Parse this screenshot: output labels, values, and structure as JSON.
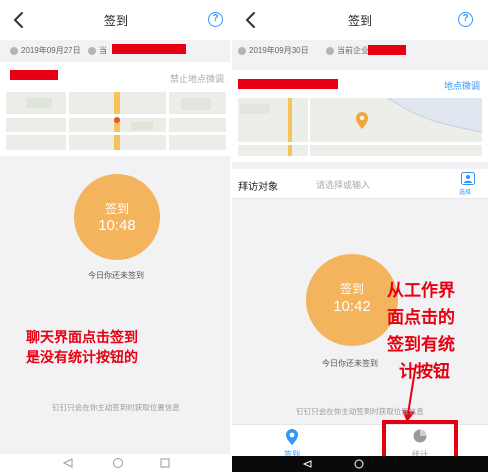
{
  "left": {
    "header": {
      "title": "签到"
    },
    "info": {
      "date": "2019年09月27日",
      "company_prefix": "当"
    },
    "location": {
      "action": "禁止地点微调"
    },
    "sign": {
      "label": "签到",
      "time": "10:48"
    },
    "status": "今日你还未签到",
    "privacy": "钉钉只会在你主动签到时获取位置信息",
    "annotation": [
      "聊天界面点击签到",
      "是没有统计按钮的"
    ]
  },
  "right": {
    "header": {
      "title": "签到"
    },
    "info": {
      "date": "2019年09月30日",
      "company_prefix": "当前企业"
    },
    "location": {
      "action": "地点微调"
    },
    "visit": {
      "label": "拜访对象",
      "placeholder": "请选择或输入",
      "select_label": "选择"
    },
    "sign": {
      "label": "签到",
      "time": "10:42"
    },
    "status": "今日你还未签到",
    "privacy": "钉钉只会在你主动签到时获取位置信息",
    "annotation": [
      "从工作界",
      "面点击的",
      "签到有统",
      "计按钮"
    ],
    "tabs": [
      {
        "label": "签到",
        "icon": "location-person-icon",
        "active": true
      },
      {
        "label": "统计",
        "icon": "pie-chart-icon",
        "active": false
      }
    ]
  },
  "colors": {
    "accent": "#3296fa",
    "sign_button": "#f4b35d",
    "annotation": "#e60012",
    "background": "#f2f2f5"
  }
}
